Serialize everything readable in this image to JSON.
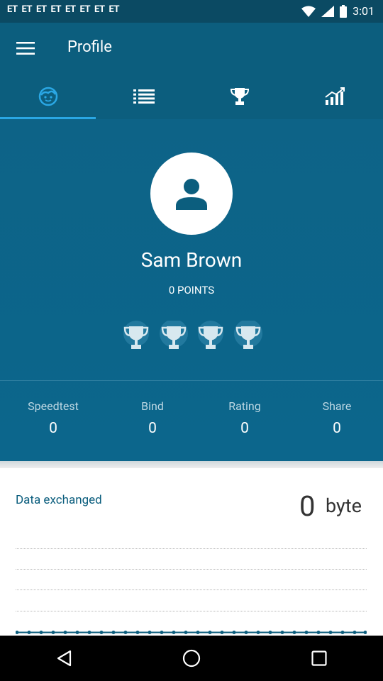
{
  "status_bar": {
    "notification_icons": [
      "ET",
      "ET",
      "ET",
      "ET",
      "ET",
      "ET",
      "ET",
      "ET"
    ],
    "time": "3:01"
  },
  "app_bar": {
    "title": "Profile"
  },
  "tabs": [
    {
      "icon": "face-icon",
      "active": true
    },
    {
      "icon": "list-icon",
      "active": false
    },
    {
      "icon": "trophy-icon",
      "active": false
    },
    {
      "icon": "chart-icon",
      "active": false
    }
  ],
  "profile": {
    "name": "Sam Brown",
    "points": "0 POINTS",
    "trophies": [
      "trophy-icon",
      "trophy-icon",
      "trophy-icon",
      "trophy-icon"
    ]
  },
  "stats": [
    {
      "label": "Speedtest",
      "value": "0"
    },
    {
      "label": "Bind",
      "value": "0"
    },
    {
      "label": "Rating",
      "value": "0"
    },
    {
      "label": "Share",
      "value": "0"
    }
  ],
  "data_exchanged": {
    "label": "Data exchanged",
    "value": "0",
    "unit": "byte"
  },
  "colors": {
    "primary": "#0c5e7e",
    "status_bar": "#0b4a63",
    "accent": "#2aa7e4"
  }
}
